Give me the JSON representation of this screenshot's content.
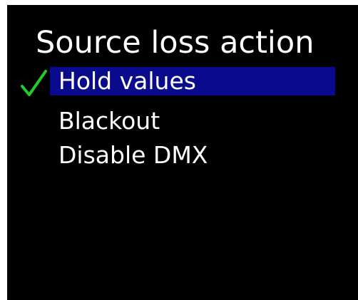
{
  "screen": {
    "title": "Source loss action",
    "background_color": "#000000",
    "text_color": "#ffffff",
    "highlight_color": "#0a0a8c",
    "check_color": "#22cc22"
  },
  "menu": {
    "items": [
      {
        "label": "Hold values",
        "selected": true,
        "checked": true,
        "icon": "checkmark-icon"
      },
      {
        "label": "Blackout",
        "selected": false,
        "checked": false
      },
      {
        "label": "Disable DMX",
        "selected": false,
        "checked": false
      }
    ]
  }
}
